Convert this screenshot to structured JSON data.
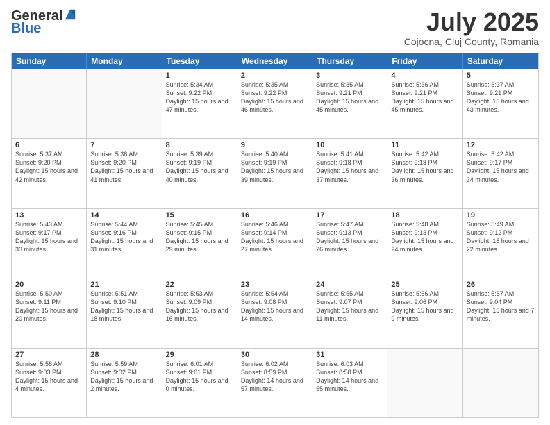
{
  "header": {
    "logo_general": "General",
    "logo_blue": "Blue",
    "month_title": "July 2025",
    "location": "Cojocna, Cluj County, Romania"
  },
  "calendar": {
    "days_of_week": [
      "Sunday",
      "Monday",
      "Tuesday",
      "Wednesday",
      "Thursday",
      "Friday",
      "Saturday"
    ],
    "weeks": [
      [
        {
          "day": "",
          "empty": true
        },
        {
          "day": "",
          "empty": true
        },
        {
          "day": "1",
          "sunrise": "Sunrise: 5:34 AM",
          "sunset": "Sunset: 9:22 PM",
          "daylight": "Daylight: 15 hours and 47 minutes."
        },
        {
          "day": "2",
          "sunrise": "Sunrise: 5:35 AM",
          "sunset": "Sunset: 9:22 PM",
          "daylight": "Daylight: 15 hours and 46 minutes."
        },
        {
          "day": "3",
          "sunrise": "Sunrise: 5:35 AM",
          "sunset": "Sunset: 9:21 PM",
          "daylight": "Daylight: 15 hours and 45 minutes."
        },
        {
          "day": "4",
          "sunrise": "Sunrise: 5:36 AM",
          "sunset": "Sunset: 9:21 PM",
          "daylight": "Daylight: 15 hours and 45 minutes."
        },
        {
          "day": "5",
          "sunrise": "Sunrise: 5:37 AM",
          "sunset": "Sunset: 9:21 PM",
          "daylight": "Daylight: 15 hours and 43 minutes."
        }
      ],
      [
        {
          "day": "6",
          "sunrise": "Sunrise: 5:37 AM",
          "sunset": "Sunset: 9:20 PM",
          "daylight": "Daylight: 15 hours and 42 minutes."
        },
        {
          "day": "7",
          "sunrise": "Sunrise: 5:38 AM",
          "sunset": "Sunset: 9:20 PM",
          "daylight": "Daylight: 15 hours and 41 minutes."
        },
        {
          "day": "8",
          "sunrise": "Sunrise: 5:39 AM",
          "sunset": "Sunset: 9:19 PM",
          "daylight": "Daylight: 15 hours and 40 minutes."
        },
        {
          "day": "9",
          "sunrise": "Sunrise: 5:40 AM",
          "sunset": "Sunset: 9:19 PM",
          "daylight": "Daylight: 15 hours and 39 minutes."
        },
        {
          "day": "10",
          "sunrise": "Sunrise: 5:41 AM",
          "sunset": "Sunset: 9:18 PM",
          "daylight": "Daylight: 15 hours and 37 minutes."
        },
        {
          "day": "11",
          "sunrise": "Sunrise: 5:42 AM",
          "sunset": "Sunset: 9:18 PM",
          "daylight": "Daylight: 15 hours and 36 minutes."
        },
        {
          "day": "12",
          "sunrise": "Sunrise: 5:42 AM",
          "sunset": "Sunset: 9:17 PM",
          "daylight": "Daylight: 15 hours and 34 minutes."
        }
      ],
      [
        {
          "day": "13",
          "sunrise": "Sunrise: 5:43 AM",
          "sunset": "Sunset: 9:17 PM",
          "daylight": "Daylight: 15 hours and 33 minutes."
        },
        {
          "day": "14",
          "sunrise": "Sunrise: 5:44 AM",
          "sunset": "Sunset: 9:16 PM",
          "daylight": "Daylight: 15 hours and 31 minutes."
        },
        {
          "day": "15",
          "sunrise": "Sunrise: 5:45 AM",
          "sunset": "Sunset: 9:15 PM",
          "daylight": "Daylight: 15 hours and 29 minutes."
        },
        {
          "day": "16",
          "sunrise": "Sunrise: 5:46 AM",
          "sunset": "Sunset: 9:14 PM",
          "daylight": "Daylight: 15 hours and 27 minutes."
        },
        {
          "day": "17",
          "sunrise": "Sunrise: 5:47 AM",
          "sunset": "Sunset: 9:13 PM",
          "daylight": "Daylight: 15 hours and 26 minutes."
        },
        {
          "day": "18",
          "sunrise": "Sunrise: 5:48 AM",
          "sunset": "Sunset: 9:13 PM",
          "daylight": "Daylight: 15 hours and 24 minutes."
        },
        {
          "day": "19",
          "sunrise": "Sunrise: 5:49 AM",
          "sunset": "Sunset: 9:12 PM",
          "daylight": "Daylight: 15 hours and 22 minutes."
        }
      ],
      [
        {
          "day": "20",
          "sunrise": "Sunrise: 5:50 AM",
          "sunset": "Sunset: 9:11 PM",
          "daylight": "Daylight: 15 hours and 20 minutes."
        },
        {
          "day": "21",
          "sunrise": "Sunrise: 5:51 AM",
          "sunset": "Sunset: 9:10 PM",
          "daylight": "Daylight: 15 hours and 18 minutes."
        },
        {
          "day": "22",
          "sunrise": "Sunrise: 5:53 AM",
          "sunset": "Sunset: 9:09 PM",
          "daylight": "Daylight: 15 hours and 16 minutes."
        },
        {
          "day": "23",
          "sunrise": "Sunrise: 5:54 AM",
          "sunset": "Sunset: 9:08 PM",
          "daylight": "Daylight: 15 hours and 14 minutes."
        },
        {
          "day": "24",
          "sunrise": "Sunrise: 5:55 AM",
          "sunset": "Sunset: 9:07 PM",
          "daylight": "Daylight: 15 hours and 11 minutes."
        },
        {
          "day": "25",
          "sunrise": "Sunrise: 5:56 AM",
          "sunset": "Sunset: 9:06 PM",
          "daylight": "Daylight: 15 hours and 9 minutes."
        },
        {
          "day": "26",
          "sunrise": "Sunrise: 5:57 AM",
          "sunset": "Sunset: 9:04 PM",
          "daylight": "Daylight: 15 hours and 7 minutes."
        }
      ],
      [
        {
          "day": "27",
          "sunrise": "Sunrise: 5:58 AM",
          "sunset": "Sunset: 9:03 PM",
          "daylight": "Daylight: 15 hours and 4 minutes."
        },
        {
          "day": "28",
          "sunrise": "Sunrise: 5:59 AM",
          "sunset": "Sunset: 9:02 PM",
          "daylight": "Daylight: 15 hours and 2 minutes."
        },
        {
          "day": "29",
          "sunrise": "Sunrise: 6:01 AM",
          "sunset": "Sunset: 9:01 PM",
          "daylight": "Daylight: 15 hours and 0 minutes."
        },
        {
          "day": "30",
          "sunrise": "Sunrise: 6:02 AM",
          "sunset": "Sunset: 8:59 PM",
          "daylight": "Daylight: 14 hours and 57 minutes."
        },
        {
          "day": "31",
          "sunrise": "Sunrise: 6:03 AM",
          "sunset": "Sunset: 8:58 PM",
          "daylight": "Daylight: 14 hours and 55 minutes."
        },
        {
          "day": "",
          "empty": true
        },
        {
          "day": "",
          "empty": true
        }
      ]
    ]
  }
}
